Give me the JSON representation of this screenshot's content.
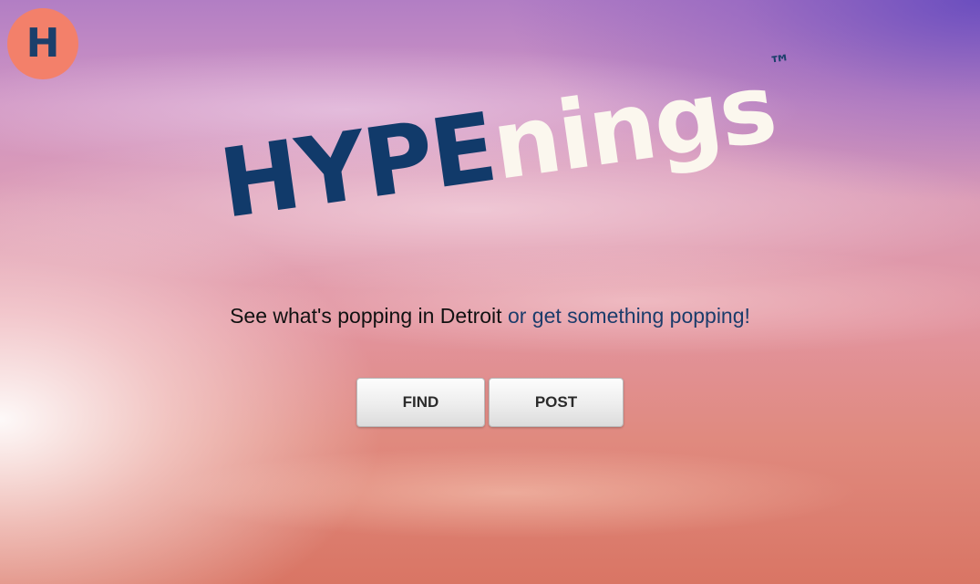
{
  "logo": {
    "letter": "H"
  },
  "brand": {
    "part_dark": "HYPE",
    "part_light": "nings",
    "trademark": "™"
  },
  "tagline": {
    "text": "See what's popping in Detroit ",
    "link": "or get something popping!"
  },
  "actions": {
    "find_label": "FIND",
    "post_label": "POST"
  },
  "colors": {
    "navy": "#113a6a",
    "badge": "#f3806a",
    "cream": "#fbf7ee"
  }
}
